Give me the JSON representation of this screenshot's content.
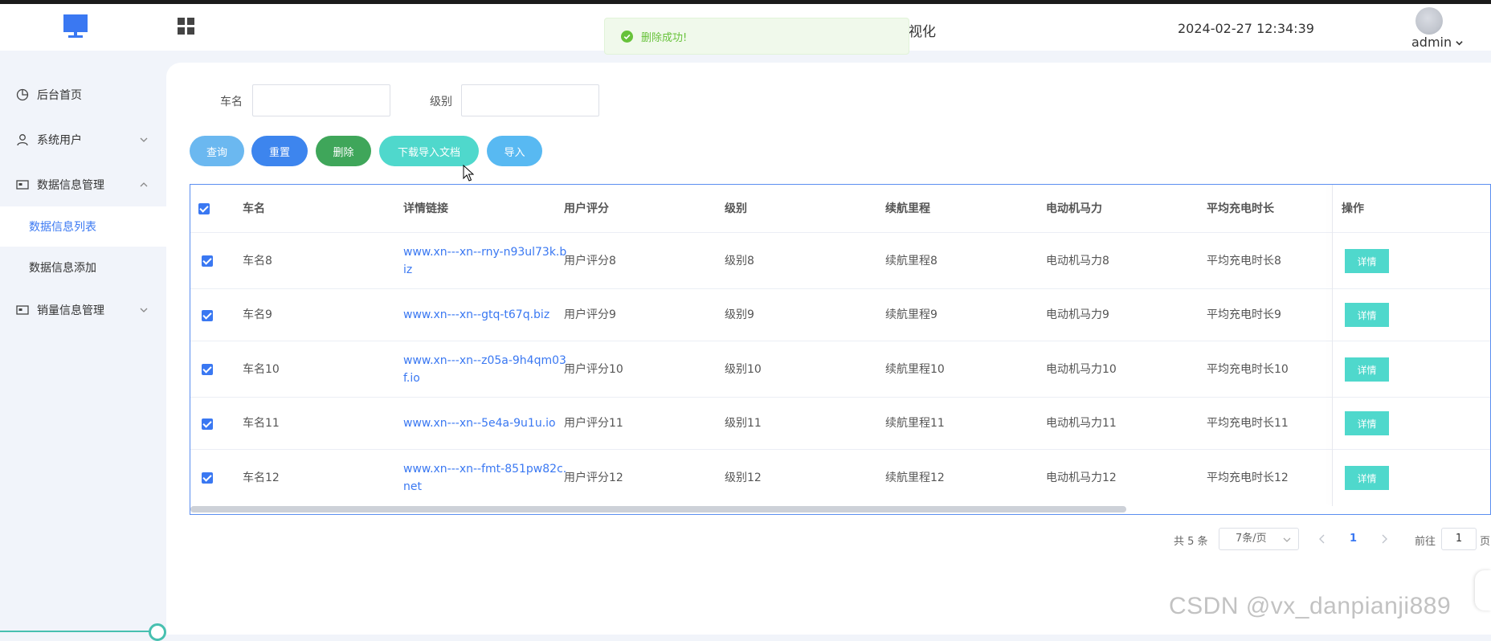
{
  "header": {
    "title_fragment": "视化",
    "datetime": "2024-02-27 12:34:39",
    "user": "admin"
  },
  "toast": {
    "message": "删除成功!",
    "type": "success"
  },
  "sidebar": {
    "items": [
      {
        "label": "后台首页",
        "icon": "dashboard-icon"
      },
      {
        "label": "系统用户",
        "icon": "user-icon",
        "expanded": false
      },
      {
        "label": "数据信息管理",
        "icon": "card-icon",
        "expanded": true,
        "children": [
          {
            "label": "数据信息列表",
            "active": true
          },
          {
            "label": "数据信息添加"
          }
        ]
      },
      {
        "label": "销量信息管理",
        "icon": "card-icon",
        "expanded": false
      }
    ]
  },
  "filters": {
    "car_name_label": "车名",
    "car_name_value": "",
    "level_label": "级别",
    "level_value": ""
  },
  "actions": {
    "query": "查询",
    "reset": "重置",
    "delete": "删除",
    "download_template": "下载导入文档",
    "import": "导入"
  },
  "colors": {
    "query": "#6bb8f0",
    "reset": "#3d85ee",
    "delete": "#3fa65a",
    "download": "#4fd8cc",
    "import": "#58b9f2",
    "primary": "#3a78f2",
    "detail": "#4fd8cc"
  },
  "table": {
    "columns": [
      "车名",
      "详情链接",
      "用户评分",
      "级别",
      "续航里程",
      "电动机马力",
      "平均充电时长",
      "操作"
    ],
    "rows": [
      {
        "name": "车名8",
        "link1": "www.xn---xn--rny-n93ul73k.b",
        "link2": "iz",
        "rating": "用户评分8",
        "level": "级别8",
        "range": "续航里程8",
        "power": "电动机马力8",
        "charge": "平均充电时长8",
        "detail": "详情"
      },
      {
        "name": "车名9",
        "link1": "www.xn---xn--gtq-t67q.biz",
        "link2": "",
        "rating": "用户评分9",
        "level": "级别9",
        "range": "续航里程9",
        "power": "电动机马力9",
        "charge": "平均充电时长9",
        "detail": "详情"
      },
      {
        "name": "车名10",
        "link1": "www.xn---xn--z05a-9h4qm03",
        "link2": "f.io",
        "rating": "用户评分10",
        "level": "级别10",
        "range": "续航里程10",
        "power": "电动机马力10",
        "charge": "平均充电时长10",
        "detail": "详情"
      },
      {
        "name": "车名11",
        "link1": "www.xn---xn--5e4a-9u1u.io",
        "link2": "",
        "rating": "用户评分11",
        "level": "级别11",
        "range": "续航里程11",
        "power": "电动机马力11",
        "charge": "平均充电时长11",
        "detail": "详情"
      },
      {
        "name": "车名12",
        "link1": "www.xn---xn--fmt-851pw82c.",
        "link2": "net",
        "rating": "用户评分12",
        "level": "级别12",
        "range": "续航里程12",
        "power": "电动机马力12",
        "charge": "平均充电时长12",
        "detail": "详情"
      }
    ]
  },
  "pagination": {
    "total": "共 5 条",
    "page_size": "7条/页",
    "current_page": "1",
    "goto_label": "前往",
    "goto_value": "1",
    "page_suffix": "页"
  },
  "watermark": "CSDN @vx_danpianji889"
}
